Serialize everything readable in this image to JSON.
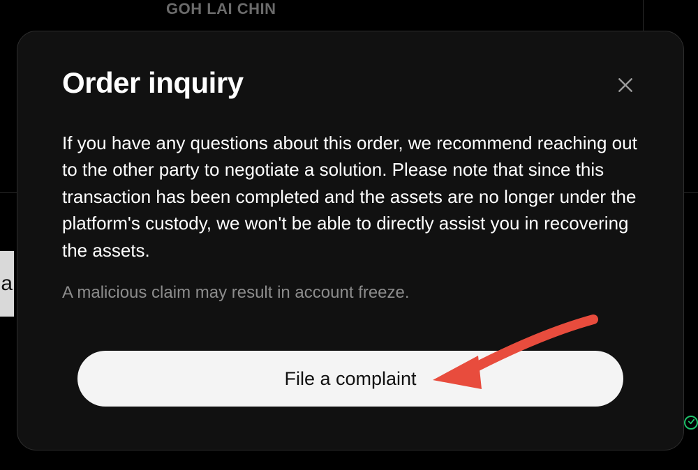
{
  "background": {
    "user_name": "GOH LAI CHIN",
    "side_char": "a"
  },
  "modal": {
    "title": "Order inquiry",
    "body_text": "If you have any questions about this order, we recommend reaching out to the other party to negotiate a solution. Please note that since this transaction has been completed and the assets are no longer under the platform's custody, we won't be able to directly assist you in recovering the assets.",
    "warning_text": "A malicious claim may result in account freeze.",
    "action_label": "File a complaint"
  },
  "annotation": {
    "arrow_color": "#e84c3d"
  }
}
